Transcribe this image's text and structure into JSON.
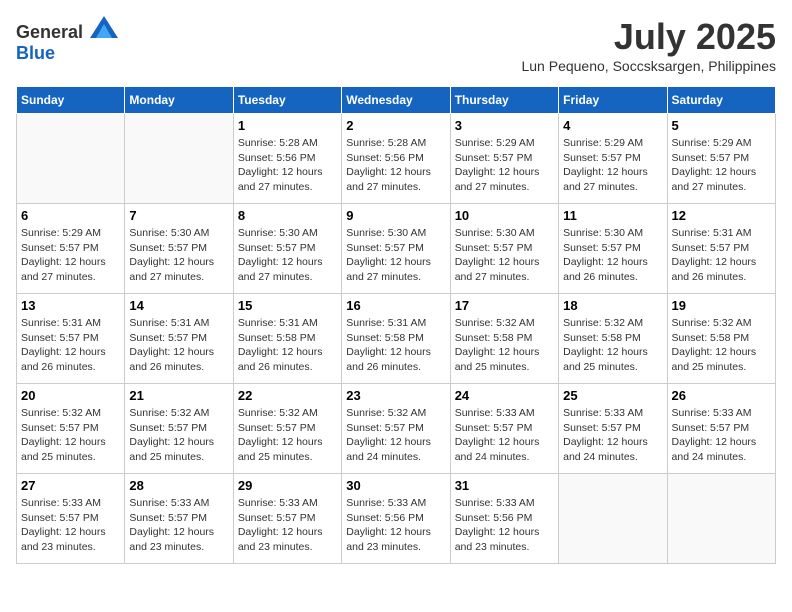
{
  "logo": {
    "general": "General",
    "blue": "Blue"
  },
  "header": {
    "month": "July 2025",
    "location": "Lun Pequeno, Soccsksargen, Philippines"
  },
  "weekdays": [
    "Sunday",
    "Monday",
    "Tuesday",
    "Wednesday",
    "Thursday",
    "Friday",
    "Saturday"
  ],
  "weeks": [
    [
      {
        "day": "",
        "detail": ""
      },
      {
        "day": "",
        "detail": ""
      },
      {
        "day": "1",
        "detail": "Sunrise: 5:28 AM\nSunset: 5:56 PM\nDaylight: 12 hours and 27 minutes."
      },
      {
        "day": "2",
        "detail": "Sunrise: 5:28 AM\nSunset: 5:56 PM\nDaylight: 12 hours and 27 minutes."
      },
      {
        "day": "3",
        "detail": "Sunrise: 5:29 AM\nSunset: 5:57 PM\nDaylight: 12 hours and 27 minutes."
      },
      {
        "day": "4",
        "detail": "Sunrise: 5:29 AM\nSunset: 5:57 PM\nDaylight: 12 hours and 27 minutes."
      },
      {
        "day": "5",
        "detail": "Sunrise: 5:29 AM\nSunset: 5:57 PM\nDaylight: 12 hours and 27 minutes."
      }
    ],
    [
      {
        "day": "6",
        "detail": "Sunrise: 5:29 AM\nSunset: 5:57 PM\nDaylight: 12 hours and 27 minutes."
      },
      {
        "day": "7",
        "detail": "Sunrise: 5:30 AM\nSunset: 5:57 PM\nDaylight: 12 hours and 27 minutes."
      },
      {
        "day": "8",
        "detail": "Sunrise: 5:30 AM\nSunset: 5:57 PM\nDaylight: 12 hours and 27 minutes."
      },
      {
        "day": "9",
        "detail": "Sunrise: 5:30 AM\nSunset: 5:57 PM\nDaylight: 12 hours and 27 minutes."
      },
      {
        "day": "10",
        "detail": "Sunrise: 5:30 AM\nSunset: 5:57 PM\nDaylight: 12 hours and 27 minutes."
      },
      {
        "day": "11",
        "detail": "Sunrise: 5:30 AM\nSunset: 5:57 PM\nDaylight: 12 hours and 26 minutes."
      },
      {
        "day": "12",
        "detail": "Sunrise: 5:31 AM\nSunset: 5:57 PM\nDaylight: 12 hours and 26 minutes."
      }
    ],
    [
      {
        "day": "13",
        "detail": "Sunrise: 5:31 AM\nSunset: 5:57 PM\nDaylight: 12 hours and 26 minutes."
      },
      {
        "day": "14",
        "detail": "Sunrise: 5:31 AM\nSunset: 5:57 PM\nDaylight: 12 hours and 26 minutes."
      },
      {
        "day": "15",
        "detail": "Sunrise: 5:31 AM\nSunset: 5:58 PM\nDaylight: 12 hours and 26 minutes."
      },
      {
        "day": "16",
        "detail": "Sunrise: 5:31 AM\nSunset: 5:58 PM\nDaylight: 12 hours and 26 minutes."
      },
      {
        "day": "17",
        "detail": "Sunrise: 5:32 AM\nSunset: 5:58 PM\nDaylight: 12 hours and 25 minutes."
      },
      {
        "day": "18",
        "detail": "Sunrise: 5:32 AM\nSunset: 5:58 PM\nDaylight: 12 hours and 25 minutes."
      },
      {
        "day": "19",
        "detail": "Sunrise: 5:32 AM\nSunset: 5:58 PM\nDaylight: 12 hours and 25 minutes."
      }
    ],
    [
      {
        "day": "20",
        "detail": "Sunrise: 5:32 AM\nSunset: 5:57 PM\nDaylight: 12 hours and 25 minutes."
      },
      {
        "day": "21",
        "detail": "Sunrise: 5:32 AM\nSunset: 5:57 PM\nDaylight: 12 hours and 25 minutes."
      },
      {
        "day": "22",
        "detail": "Sunrise: 5:32 AM\nSunset: 5:57 PM\nDaylight: 12 hours and 25 minutes."
      },
      {
        "day": "23",
        "detail": "Sunrise: 5:32 AM\nSunset: 5:57 PM\nDaylight: 12 hours and 24 minutes."
      },
      {
        "day": "24",
        "detail": "Sunrise: 5:33 AM\nSunset: 5:57 PM\nDaylight: 12 hours and 24 minutes."
      },
      {
        "day": "25",
        "detail": "Sunrise: 5:33 AM\nSunset: 5:57 PM\nDaylight: 12 hours and 24 minutes."
      },
      {
        "day": "26",
        "detail": "Sunrise: 5:33 AM\nSunset: 5:57 PM\nDaylight: 12 hours and 24 minutes."
      }
    ],
    [
      {
        "day": "27",
        "detail": "Sunrise: 5:33 AM\nSunset: 5:57 PM\nDaylight: 12 hours and 23 minutes."
      },
      {
        "day": "28",
        "detail": "Sunrise: 5:33 AM\nSunset: 5:57 PM\nDaylight: 12 hours and 23 minutes."
      },
      {
        "day": "29",
        "detail": "Sunrise: 5:33 AM\nSunset: 5:57 PM\nDaylight: 12 hours and 23 minutes."
      },
      {
        "day": "30",
        "detail": "Sunrise: 5:33 AM\nSunset: 5:56 PM\nDaylight: 12 hours and 23 minutes."
      },
      {
        "day": "31",
        "detail": "Sunrise: 5:33 AM\nSunset: 5:56 PM\nDaylight: 12 hours and 23 minutes."
      },
      {
        "day": "",
        "detail": ""
      },
      {
        "day": "",
        "detail": ""
      }
    ]
  ]
}
